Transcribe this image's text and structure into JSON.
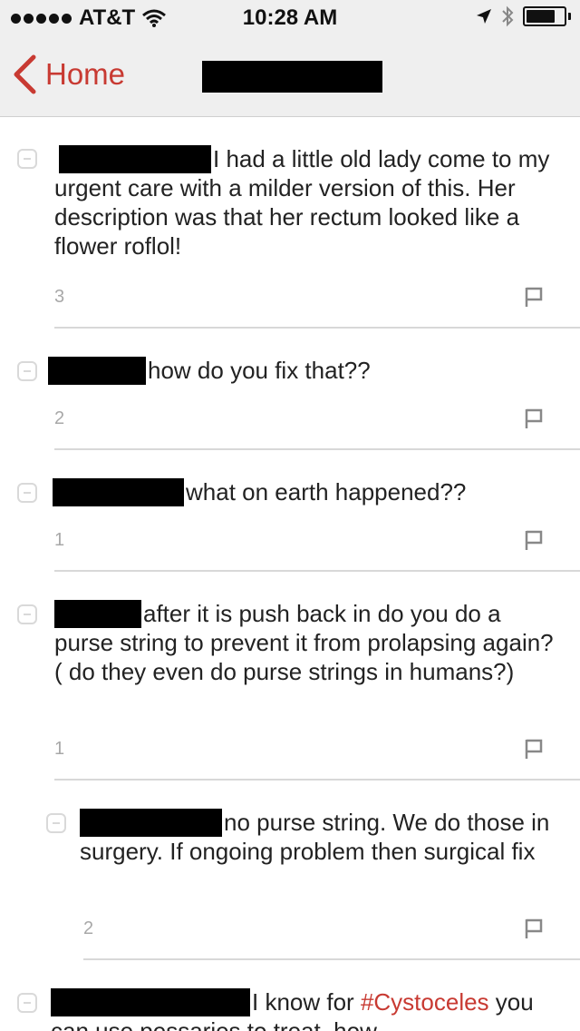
{
  "status_bar": {
    "carrier": "AT&T",
    "time": "10:28 AM",
    "signal_bars": 5,
    "battery_level": 0.8
  },
  "nav": {
    "back_label": "Home",
    "title": ""
  },
  "comments": [
    {
      "text": "I had a little old lady come to my urgent care with a milder version of this.  Her description was that her rectum looked like a flower roflol!",
      "votes": "3"
    },
    {
      "text": "how do you fix that??",
      "votes": "2"
    },
    {
      "text": "what on earth happened??",
      "votes": "1"
    },
    {
      "text": "after it is push back in do you do a purse string to prevent it from prolapsing again? ( do they even do purse strings in humans?)",
      "votes": "1"
    },
    {
      "text": "no purse string. We do those in surgery. If ongoing problem then surgical fix",
      "votes": "2",
      "reply": true
    },
    {
      "text": "I know for ",
      "hashtag": "#Cystoceles",
      "text_after": " you can use pessaries to treat. how"
    }
  ],
  "colors": {
    "accent": "#c83a32",
    "nav_background": "#efefef",
    "divider": "#d8d8d8",
    "muted_text": "#a8a8a8"
  },
  "icons": {
    "back": "chevron-left-icon",
    "collapse": "collapse-minus-icon",
    "flag": "flag-icon",
    "wifi": "wifi-icon",
    "location": "location-arrow-icon",
    "bluetooth": "bluetooth-icon",
    "battery": "battery-icon"
  }
}
